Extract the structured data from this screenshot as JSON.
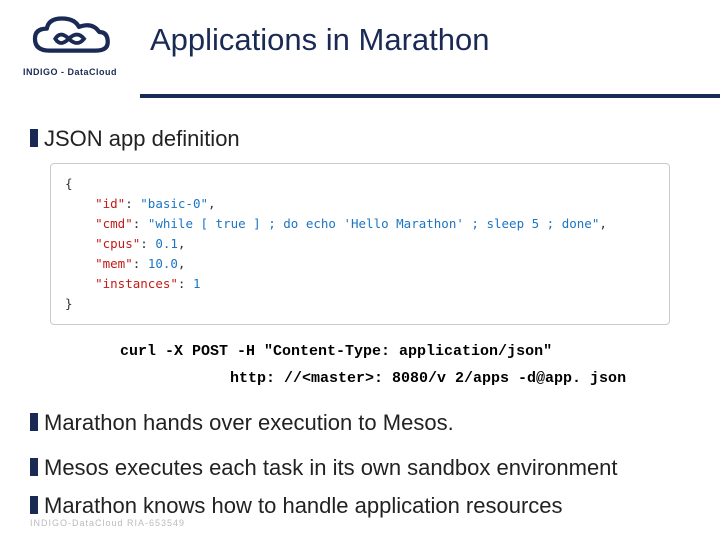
{
  "header": {
    "logo_text": "INDIGO - DataCloud",
    "title": "Applications in Marathon"
  },
  "bullets": {
    "b1": "JSON app definition",
    "b2": "Marathon hands over execution to Mesos.",
    "b3": "Mesos executes each task in its own sandbox environment",
    "b4": "Marathon knows how to handle application resources"
  },
  "code": {
    "open": "{",
    "l1_key": "\"id\"",
    "l1_colon": ": ",
    "l1_val": "\"basic-0\"",
    "l1_comma": ",",
    "l2_key": "\"cmd\"",
    "l2_colon": ": ",
    "l2_val": "\"while [ true ] ; do echo 'Hello Marathon' ; sleep 5 ; done\"",
    "l2_comma": ",",
    "l3_key": "\"cpus\"",
    "l3_colon": ": ",
    "l3_val": "0.1",
    "l3_comma": ",",
    "l4_key": "\"mem\"",
    "l4_colon": ": ",
    "l4_val": "10.0",
    "l4_comma": ",",
    "l5_key": "\"instances\"",
    "l5_colon": ": ",
    "l5_val": "1",
    "close": "}"
  },
  "cmd": {
    "line1": "curl -X POST -H \"Content-Type: application/json\"",
    "line2": "http: //<master>: 8080/v 2/apps -d@app. json"
  },
  "footer": "INDIGO-DataCloud RIA-653549"
}
